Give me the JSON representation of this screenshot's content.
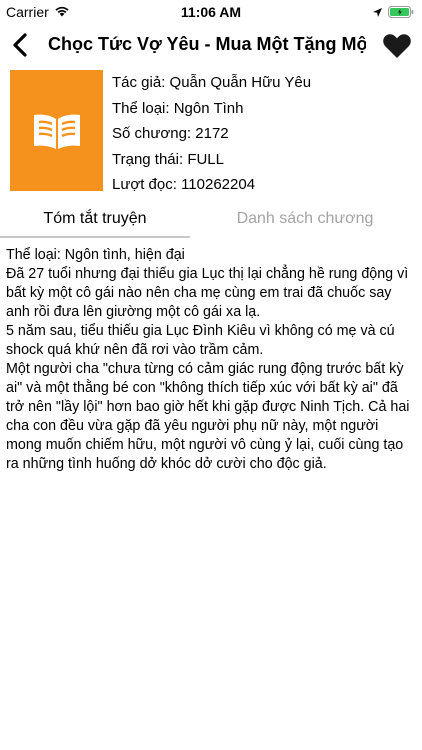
{
  "status_bar": {
    "carrier": "Carrier",
    "time": "11:06 AM",
    "battery_color": "#34c759"
  },
  "nav": {
    "title": "Chọc Tức Vợ Yêu - Mua Một Tặng Một",
    "back_icon": "chevron-left-icon",
    "favorite_icon": "heart-icon"
  },
  "book": {
    "cover_color": "#f5921e",
    "cover_icon": "open-book-icon",
    "author": "Tác giả: Quẫn Quẫn Hữu Yêu",
    "genre": "Thể loại: Ngôn Tình",
    "chapters": "Số chương: 2172",
    "status": "Trạng thái: FULL",
    "views": "Lượt đọc: 110262204"
  },
  "tabs": {
    "summary": "Tóm tắt truyện",
    "chapter_list": "Danh sách chương"
  },
  "summary_text": "Thể loại: Ngôn tình, hiện đại\nĐã 27 tuổi nhưng đại thiếu gia Lục thị lại chẳng hề rung động vì bất kỳ một cô gái nào nên cha mẹ cùng em trai đã chuốc say anh rồi đưa lên giường một cô gái xa lạ.\n5 năm sau, tiểu thiếu gia Lục Đình Kiêu vì không có mẹ và cú shock quá khứ nên đã rơi vào trầm cảm.\nMột người cha \"chưa từng có cảm giác rung động trước bất kỳ ai\" và một thằng bé con \"không thích tiếp xúc với bất kỳ ai\" đã trở nên \"lầy lội\" hơn bao giờ hết khi gặp được Ninh Tịch. Cả hai cha con đều vừa gặp đã yêu người phụ nữ này, một người mong muốn chiếm hữu, một người vô cùng ỷ lại, cuối cùng tạo ra những tình huống dở khóc dở cười cho độc giả."
}
